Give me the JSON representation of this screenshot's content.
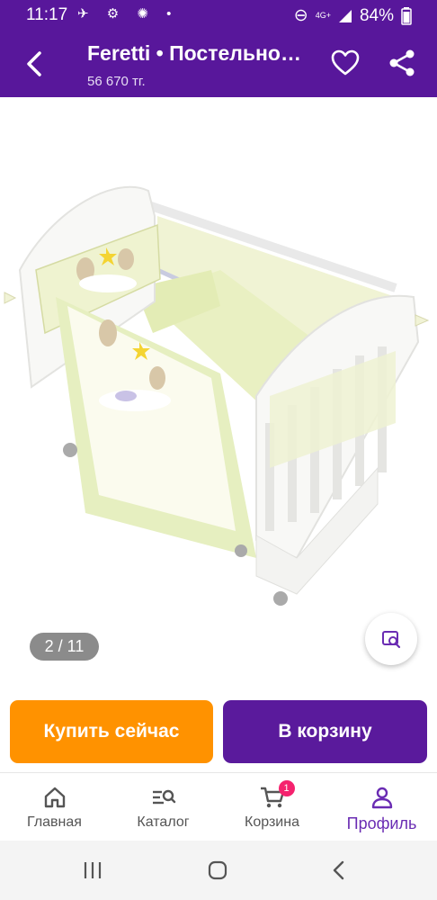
{
  "status_bar": {
    "time": "11:17",
    "network_type": "4G+",
    "battery": "84%"
  },
  "app_bar": {
    "title": "Feretti • Постельное белье",
    "price": "56 670 тг."
  },
  "gallery": {
    "counter": "2 / 11"
  },
  "actions": {
    "buy_now": "Купить сейчас",
    "add_to_cart": "В корзину"
  },
  "bottom_nav": {
    "items": [
      {
        "label": "Главная",
        "icon": "home-icon"
      },
      {
        "label": "Каталог",
        "icon": "catalog-search-icon"
      },
      {
        "label": "Корзина",
        "icon": "cart-icon",
        "badge": "1"
      },
      {
        "label": "Профиль",
        "icon": "profile-icon",
        "active": true
      }
    ]
  },
  "colors": {
    "brand_purple": "#58179b",
    "buy_orange": "#ff9200",
    "badge_pink": "#f5226e",
    "active_nav": "#6a2cb3"
  }
}
